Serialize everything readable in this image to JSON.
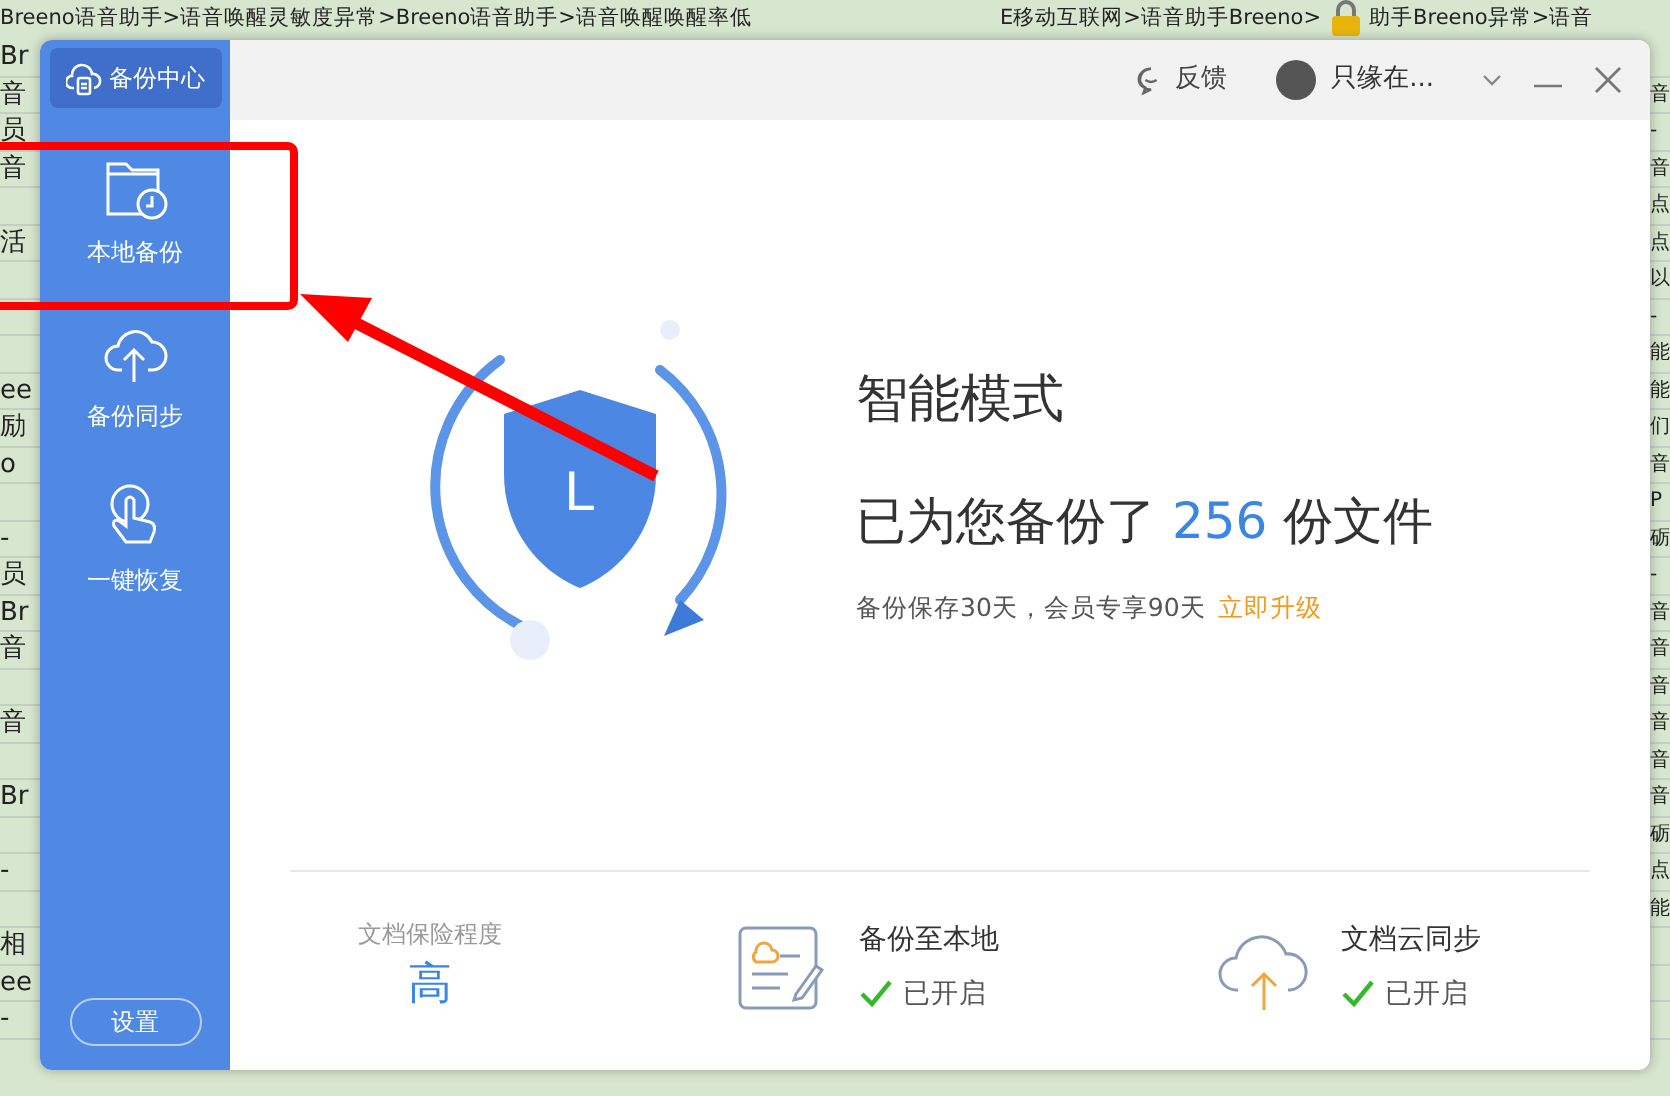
{
  "background": {
    "top_left": "Breeno语音助手>语音唤醒灵敏度异常>Breeno语音助手>语音唤醒唤醒率低",
    "top_right": [
      "E移动互联网>语音助手Breeno>",
      "助手Breeno异常>语音"
    ],
    "rows": [
      {
        "left": "Br"
      },
      {
        "left": "音",
        "right": "音"
      },
      {
        "left": "员",
        "right": "-"
      },
      {
        "left": "音",
        "right": "音"
      },
      {
        "right": "点"
      },
      {
        "left": "活",
        "right": "点"
      },
      {
        "right": "以"
      },
      {
        "right": "-"
      },
      {
        "right": "能"
      },
      {
        "left": "ee",
        "right": "能"
      },
      {
        "left": "励",
        "right": "们"
      },
      {
        "left": "o",
        "right": "音"
      },
      {
        "right": "P"
      },
      {
        "left": "-",
        "right": "砺"
      },
      {
        "left": "员",
        "right": "-"
      },
      {
        "left": "Br",
        "right": "音"
      },
      {
        "left": "音",
        "right": "音"
      },
      {
        "right": "音"
      },
      {
        "left": "音",
        "right": "音"
      },
      {
        "right": "音"
      },
      {
        "left": "Br",
        "right": "音"
      },
      {
        "right": "砺"
      },
      {
        "left": "-",
        "right": "点"
      },
      {
        "right": "能"
      },
      {
        "left": "相"
      },
      {
        "left": "ee"
      },
      {
        "left": "-"
      }
    ]
  },
  "sidebar": {
    "header": "备份中心",
    "items": [
      {
        "kind": "folder",
        "label": "本地备份"
      },
      {
        "kind": "cloud",
        "label": "备份同步"
      },
      {
        "kind": "hand",
        "label": "一键恢复"
      }
    ],
    "settings": "设置"
  },
  "titlebar": {
    "feedback": "反馈",
    "user": "只缘在..."
  },
  "main": {
    "mode": "智能模式",
    "summary_before": "已为您备份了",
    "count": "256",
    "summary_after": "份文件",
    "note": "备份保存30天，会员专享90天",
    "upgrade": "立即升级",
    "shield_letter": "L"
  },
  "footer": {
    "level_label": "文档保险程度",
    "level_value": "高",
    "features": [
      {
        "kind": "local",
        "title": "备份至本地",
        "status": "已开启",
        "enabled": true
      },
      {
        "kind": "cloud",
        "title": "文档云同步",
        "status": "已开启",
        "enabled": true
      }
    ]
  }
}
